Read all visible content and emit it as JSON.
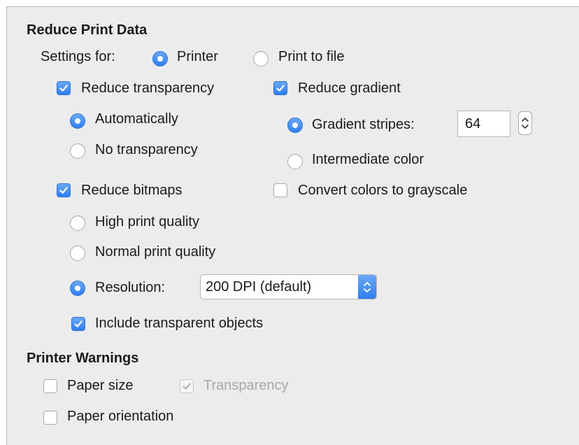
{
  "reduce_print_data": {
    "heading": "Reduce Print Data",
    "settings_for_label": "Settings for:",
    "printer_label": "Printer",
    "print_to_file_label": "Print to file",
    "reduce_transparency_label": "Reduce transparency",
    "automatically_label": "Automatically",
    "no_transparency_label": "No transparency",
    "reduce_gradient_label": "Reduce gradient",
    "gradient_stripes_label": "Gradient stripes:",
    "gradient_stripes_value": "64",
    "intermediate_color_label": "Intermediate color",
    "reduce_bitmaps_label": "Reduce bitmaps",
    "convert_grayscale_label": "Convert colors to grayscale",
    "high_quality_label": "High print quality",
    "normal_quality_label": "Normal print quality",
    "resolution_label": "Resolution:",
    "resolution_value": "200 DPI (default)",
    "include_transparent_label": "Include transparent objects"
  },
  "printer_warnings": {
    "heading": "Printer Warnings",
    "paper_size_label": "Paper size",
    "transparency_label": "Transparency",
    "paper_orientation_label": "Paper orientation"
  },
  "state": {
    "settings_for": "Printer",
    "reduce_transparency": true,
    "transparency_mode": "Automatically",
    "reduce_gradient": true,
    "gradient_mode": "Gradient stripes",
    "reduce_bitmaps": true,
    "convert_grayscale": false,
    "bitmap_mode": "Resolution",
    "include_transparent": true,
    "paper_size_warning": false,
    "transparency_warning": true,
    "transparency_warning_enabled": false,
    "paper_orientation_warning": false
  },
  "colors": {
    "accent": "#2e7ff0",
    "panel_bg": "#ececec",
    "disabled_text": "#a7a7a7"
  },
  "icons": {
    "checkmark": "checkmark-icon",
    "spin": "spin-arrows-icon",
    "select": "select-arrows-icon"
  }
}
